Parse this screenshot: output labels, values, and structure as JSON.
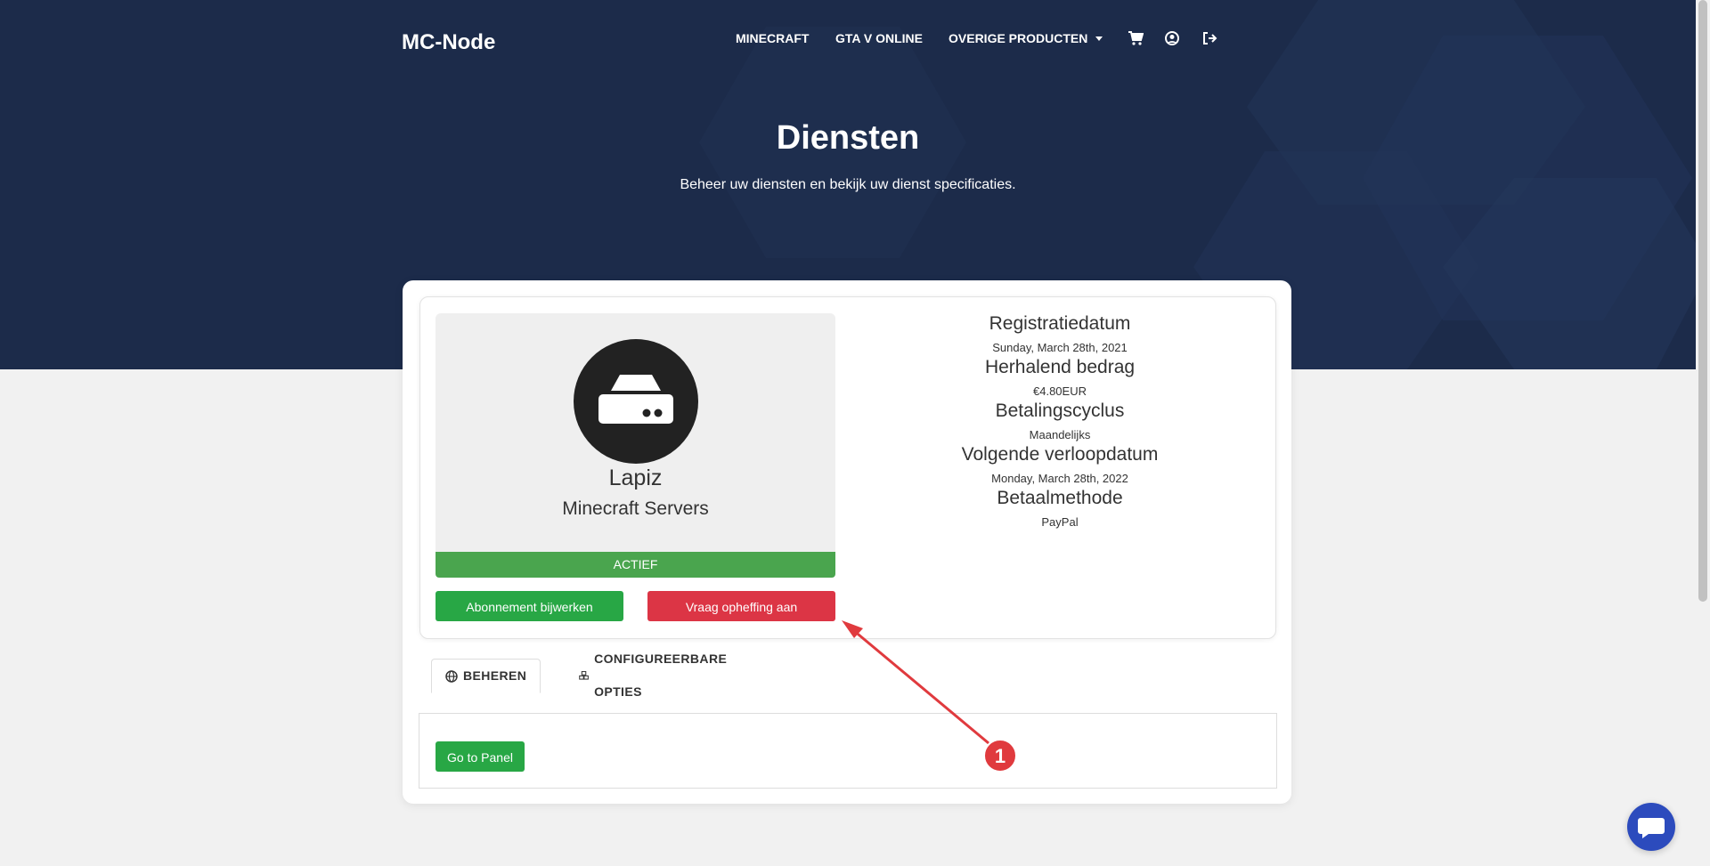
{
  "header": {
    "brand": "MC-Node",
    "nav": [
      {
        "label": "MINECRAFT"
      },
      {
        "label": "GTA V ONLINE"
      },
      {
        "label": "OVERIGE PRODUCTEN"
      }
    ],
    "icons": [
      "cart-icon",
      "user-icon",
      "logout-icon"
    ]
  },
  "hero": {
    "title": "Diensten",
    "subtitle": "Beheer uw diensten en bekijk uw dienst specificaties."
  },
  "service": {
    "icon": "server-icon",
    "name": "Lapiz",
    "group": "Minecraft Servers",
    "status": "ACTIEF",
    "buttons": {
      "upgrade": "Abonnement bijwerken",
      "cancel": "Vraag opheffing aan"
    },
    "details": [
      {
        "label": "Registratiedatum",
        "value": "Sunday, March 28th, 2021"
      },
      {
        "label": "Herhalend bedrag",
        "value": "€4.80EUR"
      },
      {
        "label": "Betalingscyclus",
        "value": "Maandelijks"
      },
      {
        "label": "Volgende verloopdatum",
        "value": "Monday, March 28th, 2022"
      },
      {
        "label": "Betaalmethode",
        "value": "PayPal"
      }
    ]
  },
  "tabs": [
    {
      "label": "BEHEREN",
      "icon": "globe-icon",
      "active": true
    },
    {
      "label": "CONFIGUREERBARE OPTIES",
      "icon": "cubes-icon",
      "active": false
    }
  ],
  "panel": {
    "go_button": "Go to Panel"
  },
  "annotation": {
    "number": "1",
    "color": "#e03a3e"
  },
  "colors": {
    "hero_bg": "#1c2b4a",
    "green": "#28a745",
    "red": "#dc3545",
    "chat": "#2c4bbd"
  }
}
